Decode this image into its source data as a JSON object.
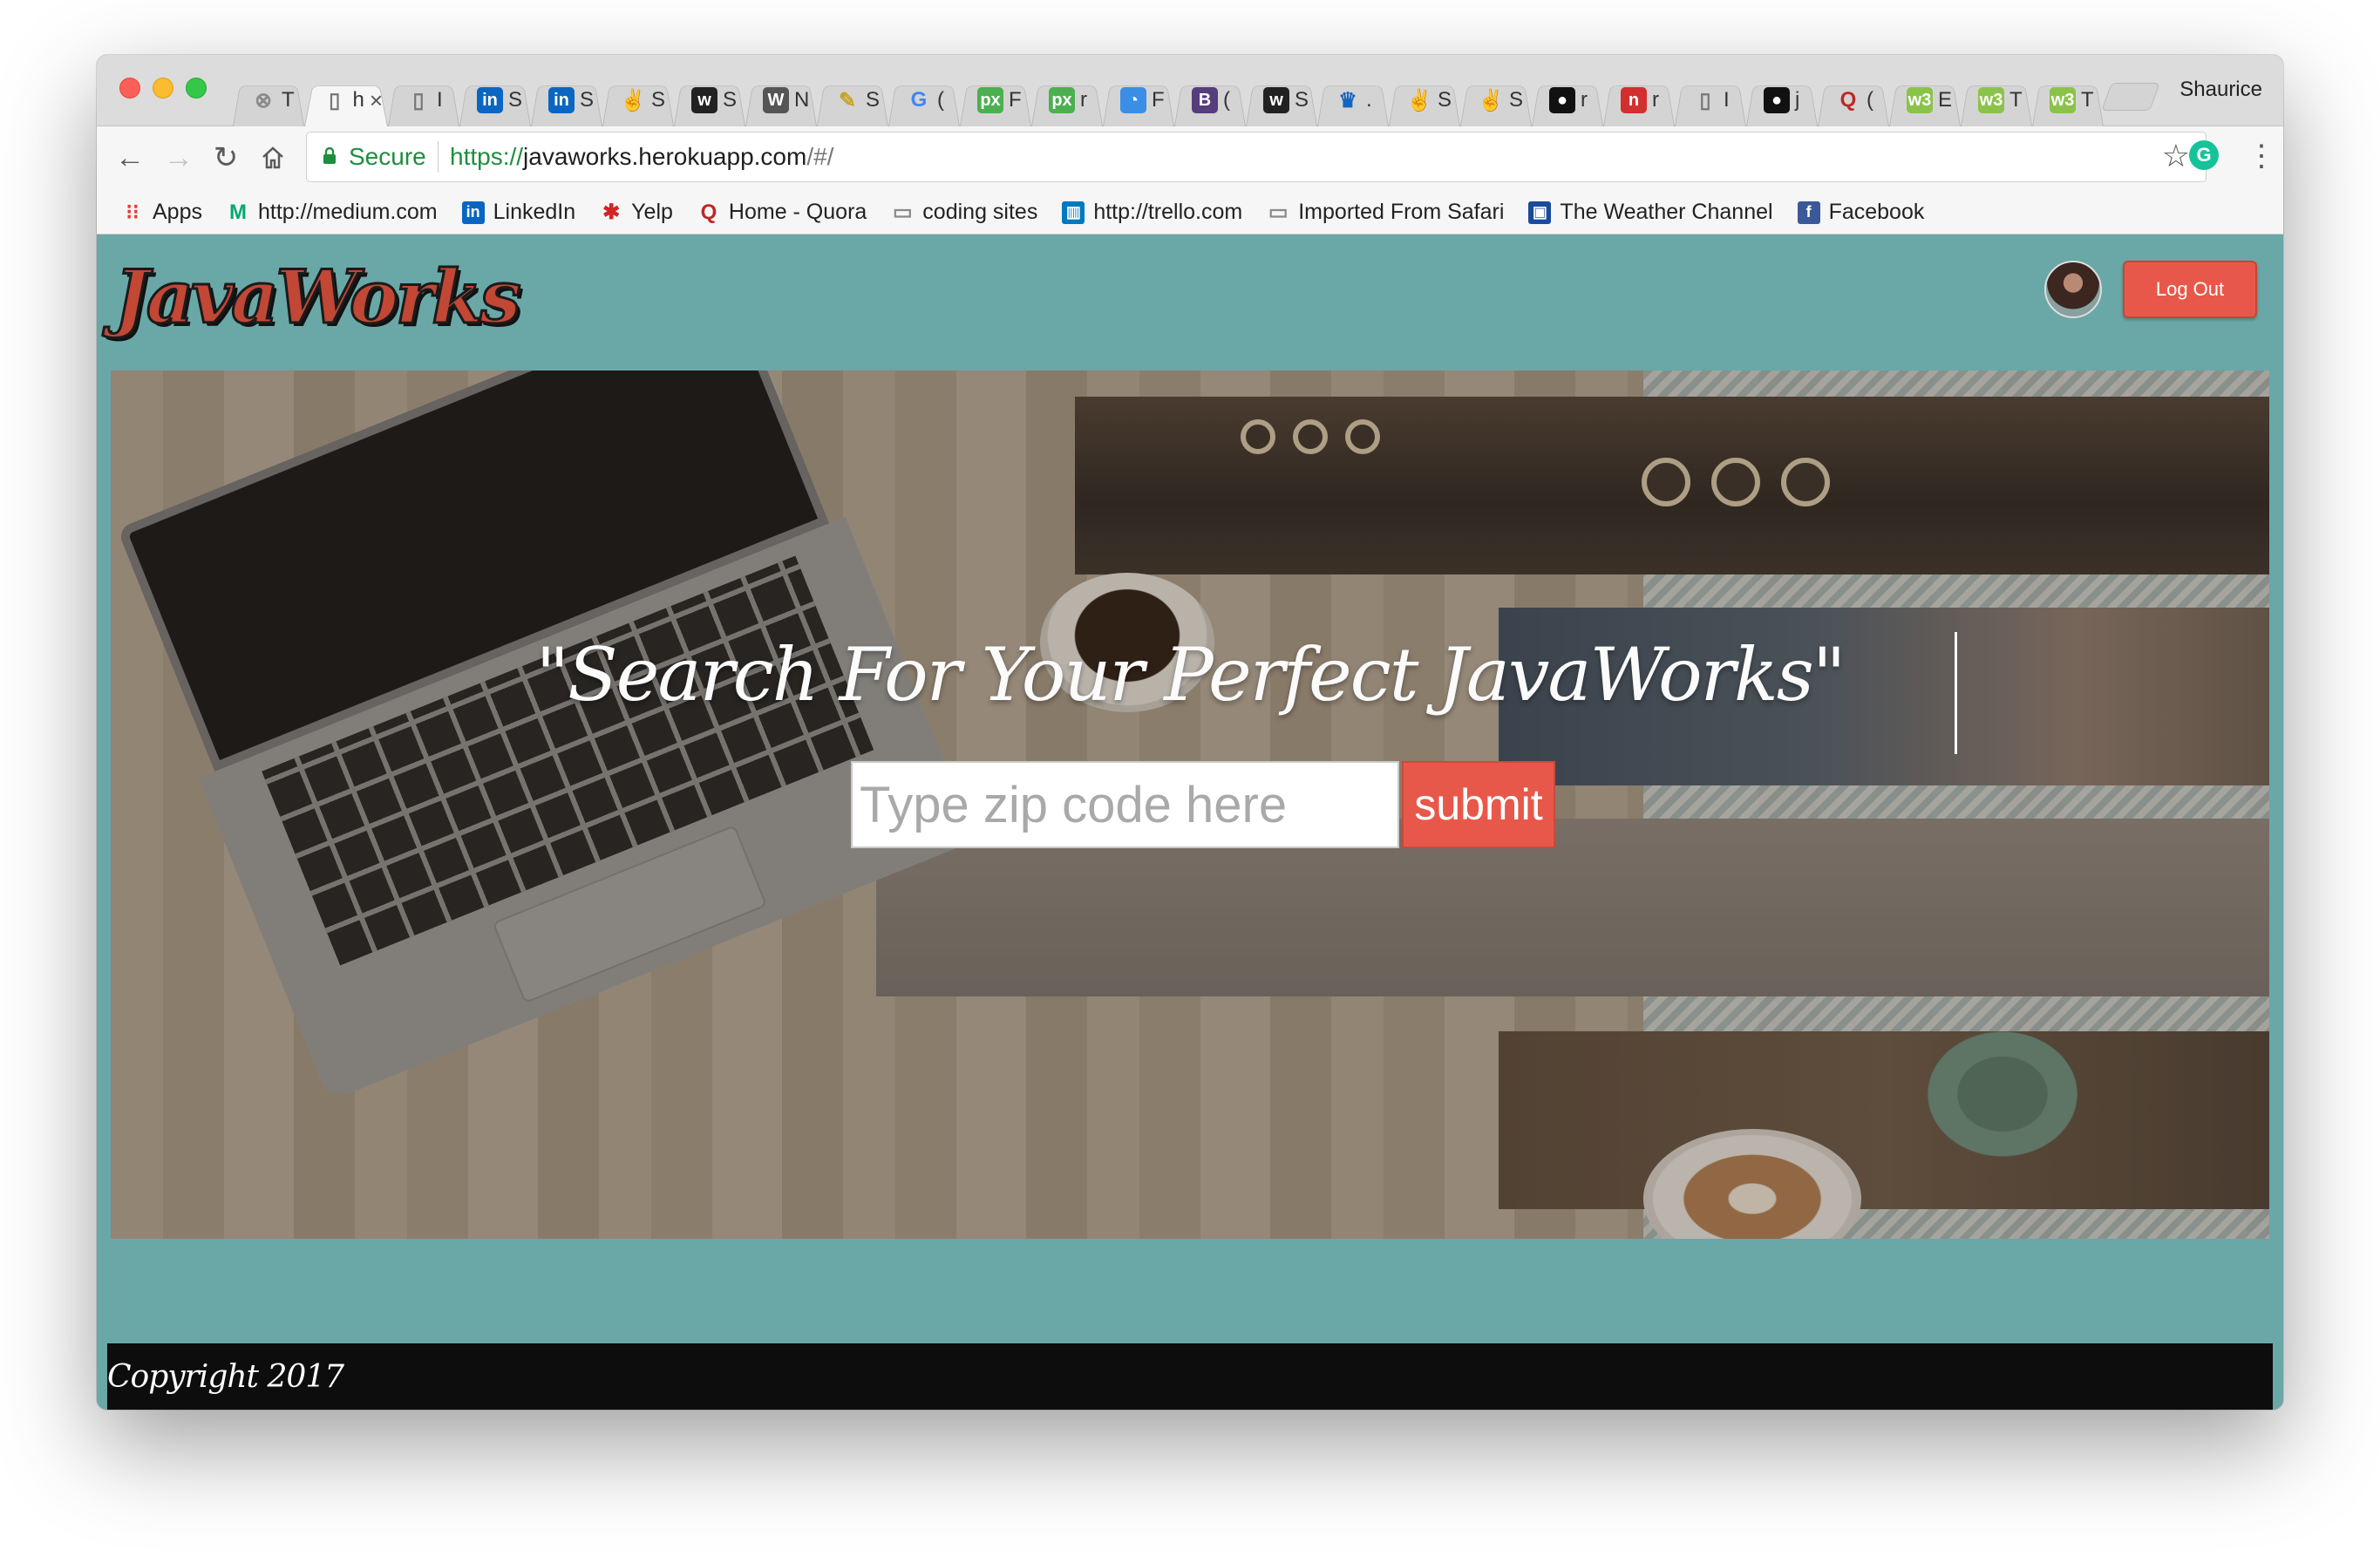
{
  "browser": {
    "profile_name": "Shaurice",
    "active_tab_title": "h",
    "tabs": [
      {
        "icon": "x-circle-icon",
        "label": "T",
        "color": "#8a8a8a"
      },
      {
        "icon": "page-icon",
        "label": "h",
        "active": true,
        "color": "#777777"
      },
      {
        "icon": "page-icon",
        "label": "I",
        "color": "#777777"
      },
      {
        "icon": "linkedin-icon",
        "label": "S",
        "color": "#0a66c2"
      },
      {
        "icon": "linkedin-icon",
        "label": "S",
        "color": "#0a66c2"
      },
      {
        "icon": "angellist-icon",
        "label": "S",
        "color": "#333333"
      },
      {
        "icon": "w-icon",
        "label": "S",
        "color": "#222222"
      },
      {
        "icon": "wordpress-icon",
        "label": "N",
        "color": "#555555"
      },
      {
        "icon": "pencil-icon",
        "label": "S",
        "color": "#c9a227"
      },
      {
        "icon": "google-icon",
        "label": "(",
        "color": "#4285f4"
      },
      {
        "icon": "px-icon",
        "label": "F",
        "color": "#4caf50"
      },
      {
        "icon": "px-icon",
        "label": "r",
        "color": "#4caf50"
      },
      {
        "icon": "chart-icon",
        "label": "F",
        "color": "#3a8ee6"
      },
      {
        "icon": "bootstrap-icon",
        "label": "(",
        "color": "#563d7c"
      },
      {
        "icon": "w-icon",
        "label": "S",
        "color": "#222222"
      },
      {
        "icon": "crown-icon",
        "label": ".",
        "color": "#1565c0"
      },
      {
        "icon": "angellist-icon",
        "label": "S",
        "color": "#333333"
      },
      {
        "icon": "angellist-icon",
        "label": "S",
        "color": "#333333"
      },
      {
        "icon": "github-icon",
        "label": "r",
        "color": "#111111"
      },
      {
        "icon": "n-icon",
        "label": "r",
        "color": "#d32f2f"
      },
      {
        "icon": "page-icon",
        "label": "I",
        "color": "#777777"
      },
      {
        "icon": "github-icon",
        "label": "j",
        "color": "#111111"
      },
      {
        "icon": "quora-icon",
        "label": "(",
        "color": "#b92b27"
      },
      {
        "icon": "w3-icon",
        "label": "E",
        "color": "#8bc34a"
      },
      {
        "icon": "w3-icon",
        "label": "T",
        "color": "#8bc34a"
      },
      {
        "icon": "w3-icon",
        "label": "T",
        "color": "#8bc34a"
      }
    ],
    "secure_label": "Secure",
    "url": {
      "scheme": "https://",
      "host": "javaworks.herokuapp.com",
      "path": "/#/"
    },
    "bookmarks": [
      {
        "icon": "apps-grid-icon",
        "label": "Apps",
        "color": "#e53935"
      },
      {
        "icon": "medium-icon",
        "label": "http://medium.com",
        "color": "#00ab6c"
      },
      {
        "icon": "linkedin-icon",
        "label": "LinkedIn",
        "color": "#0a66c2"
      },
      {
        "icon": "yelp-icon",
        "label": "Yelp",
        "color": "#d32323"
      },
      {
        "icon": "quora-icon",
        "label": "Home - Quora",
        "color": "#b92b27"
      },
      {
        "icon": "folder-icon",
        "label": "coding sites",
        "color": "#8a8a8a"
      },
      {
        "icon": "trello-icon",
        "label": "http://trello.com",
        "color": "#0079bf"
      },
      {
        "icon": "folder-icon",
        "label": "Imported From Safari",
        "color": "#8a8a8a"
      },
      {
        "icon": "weather-channel-icon",
        "label": "The Weather Channel",
        "color": "#1a4a9c"
      },
      {
        "icon": "facebook-icon",
        "label": "Facebook",
        "color": "#3b5998"
      }
    ]
  },
  "app": {
    "logo_text": "JavaWorks",
    "logout_label": "Log Out",
    "hero_heading": "\"Search For Your Perfect JavaWorks\"",
    "zip_placeholder": "Type zip code here",
    "submit_label": "submit",
    "footer_text": "Copyright 2017",
    "colors": {
      "background": "#69a8a7",
      "accent": "#e8584a",
      "footer": "#0d0d0d"
    }
  }
}
